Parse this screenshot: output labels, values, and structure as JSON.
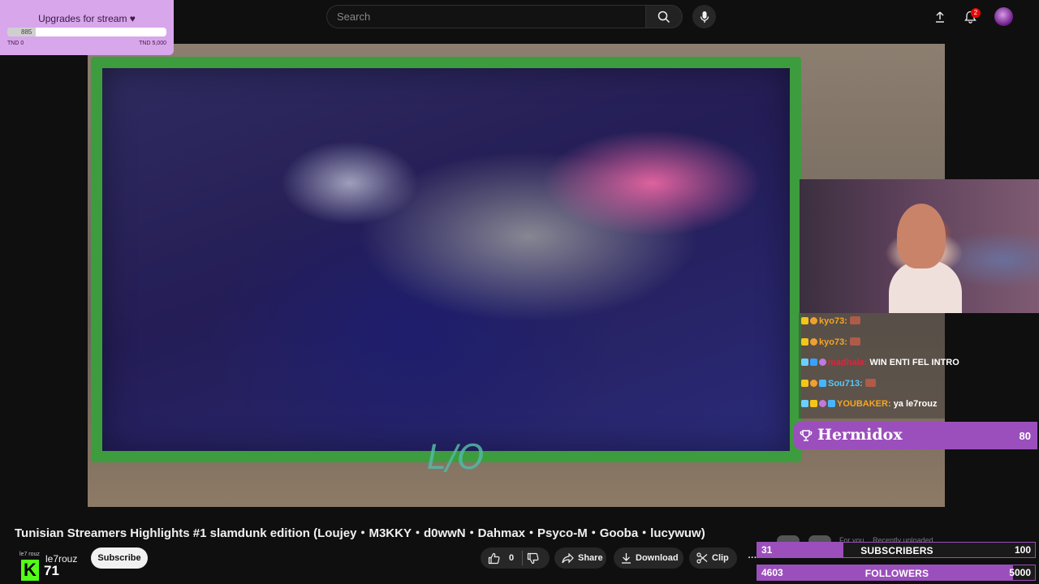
{
  "search": {
    "placeholder": "Search"
  },
  "notifications": {
    "count": "2"
  },
  "upgrade_widget": {
    "title": "Upgrades for stream ♥",
    "current": "885",
    "progress_fraction": 0.177,
    "min_label": "TND 0",
    "max_label": "TND 5,000"
  },
  "stream": {
    "overlay_logo": "L/O"
  },
  "chat": {
    "messages": [
      {
        "user": "kyo73:",
        "user_color": "#f5a623",
        "text": ""
      },
      {
        "user": "kyo73:",
        "user_color": "#f5a623",
        "text": ""
      },
      {
        "user": "madhala:",
        "user_color": "#e0243a",
        "text": "WIN ENTI FEL INTRO"
      },
      {
        "user": "Sou713:",
        "user_color": "#56c8ff",
        "text": ""
      },
      {
        "user": "YOUBAKER:",
        "user_color": "#f5a623",
        "text": "ya le7rouz"
      }
    ]
  },
  "top_donor": {
    "name": "Hermidox",
    "value": "80"
  },
  "video": {
    "title": "Tunisian Streamers Highlights #1 slamdunk edition (Loujey・M3KKY・d0wwN・Dahmax・Psyco-M・Gooba・lucywuw)"
  },
  "channel": {
    "logo_text": "le7 rouz",
    "logo_letter": "K",
    "name": "le7rouz",
    "count_overlay": "71",
    "subscribe_label": "Subscribe"
  },
  "actions": {
    "like_count": "0",
    "share_label": "Share",
    "download_label": "Download",
    "clip_label": "Clip",
    "more_label": "···"
  },
  "chips": {
    "items": [
      "For you",
      "Recently uploaded"
    ]
  },
  "counters": {
    "subscribers": {
      "current": "31",
      "label": "SUBSCRIBERS",
      "goal": "100",
      "fraction": 0.31
    },
    "followers": {
      "current": "4603",
      "label": "FOLLOWERS",
      "goal": "5000",
      "fraction": 0.9206
    }
  },
  "colors": {
    "accent_purple": "#9b4fbc",
    "kick_green": "#53fc18",
    "frame_green": "#3d9c3e"
  }
}
